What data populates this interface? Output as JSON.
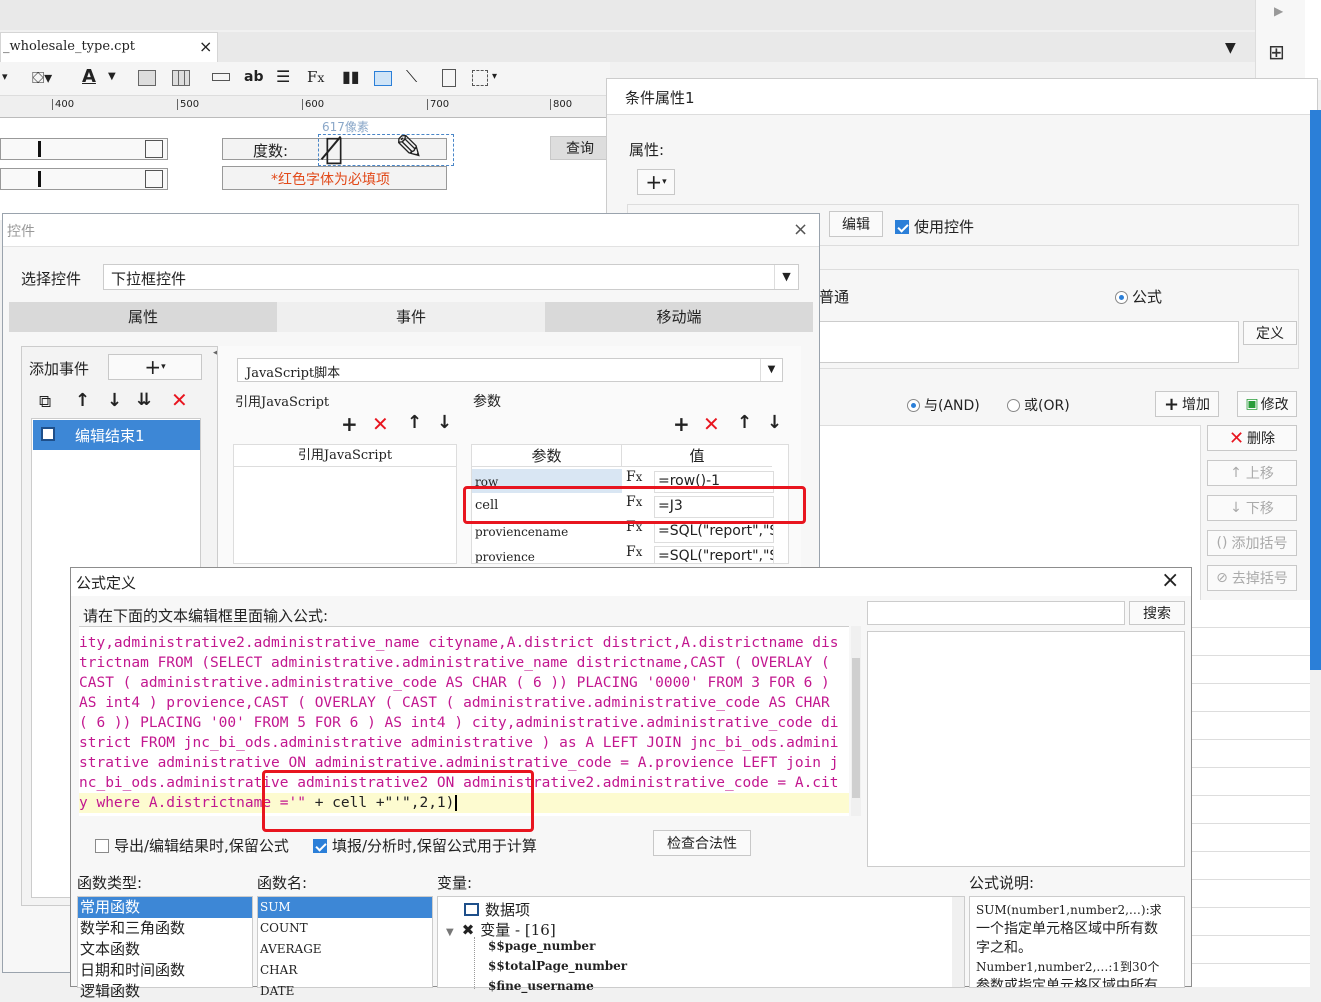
{
  "editor_tab": {
    "filename": "_wholesale_type.cpt",
    "close": "×"
  },
  "ruler": {
    "marks": [
      "400",
      "500",
      "600",
      "700",
      "800"
    ]
  },
  "canvas": {
    "widget_label": "度数:",
    "required_hint": "*红色字体为必填项",
    "size_label": "617像素",
    "query_button": "查询"
  },
  "right_panel": {
    "title": "条件属性1",
    "attr_label": "属性:",
    "add": "+",
    "edit_button": "编辑",
    "use_widget_label": "使用控件",
    "mode_normal": "普通",
    "mode_formula": "公式",
    "define_button": "定义",
    "and_label": "与(AND)",
    "or_label": "或(OR)",
    "add_button": "增加",
    "modify_button": "修改",
    "delete_button": "删除",
    "move_up_button": "上移",
    "move_down_button": "下移",
    "add_bracket_button": "添加括号",
    "remove_bracket_button": "去掉括号"
  },
  "widget_dialog": {
    "title": "控件",
    "select_label": "选择控件",
    "select_value": "下拉框控件",
    "tabs": [
      "属性",
      "事件",
      "移动端"
    ],
    "add_event_label": "添加事件",
    "event_item": "编辑结束1",
    "script_type": "JavaScript脚本",
    "ref_js_label": "引用JavaScript",
    "params_label": "参数",
    "ref_js_column": "引用JavaScript",
    "param_header": "参数",
    "value_header": "值",
    "params": [
      {
        "name": "row",
        "value": "=row()-1"
      },
      {
        "name": "cell",
        "value": "=J3"
      },
      {
        "name": "proviencename",
        "value": "=SQL(\"report\",\"S"
      },
      {
        "name": "provience",
        "value": "=SQL(\"report\",\"S"
      }
    ]
  },
  "formula_dialog": {
    "title": "公式定义",
    "close": "×",
    "instruction": "请在下面的文本编辑框里面输入公式:",
    "search_button": "搜索",
    "code_lines": [
      "ity,administrative2.administrative_name cityname,A.district district,A.districtname dis",
      "trictnam FROM (SELECT administrative.administrative_name districtname,CAST ( OVERLAY (",
      "CAST ( administrative.administrative_code AS CHAR ( 6 )) PLACING '0000' FROM 3 FOR 6 )",
      "AS int4 ) provience,CAST ( OVERLAY ( CAST ( administrative.administrative_code AS CHAR",
      "( 6 )) PLACING '00' FROM 5 FOR 6 ) AS int4 ) city,administrative.administrative_code di",
      "strict FROM jnc_bi_ods.administrative administrative ) as A LEFT JOIN jnc_bi_ods.admini",
      "strative administrative ON administrative.administrative_code = A.provience LEFT join j",
      "nc_bi_ods.administrative administrative2 ON administrative2.administrative_code = A.cit"
    ],
    "last_line_magenta": "y where A.districtname ='\"",
    "last_line_black": " + cell +\"'\",2,1)",
    "option_export": "导出/编辑结果时,保留公式",
    "option_fill": "填报/分析时,保留公式用于计算",
    "check_button": "检查合法性",
    "func_type_label": "函数类型:",
    "func_types": [
      "常用函数",
      "数学和三角函数",
      "文本函数",
      "日期和时间函数",
      "逻辑函数"
    ],
    "func_name_label": "函数名:",
    "func_names": [
      "SUM",
      "COUNT",
      "AVERAGE",
      "CHAR",
      "DATE"
    ],
    "var_label": "变量:",
    "var_tree": [
      {
        "text": "数据项",
        "level": 0
      },
      {
        "text": "变量 - [16]",
        "level": 0
      },
      {
        "text": "$$page_number",
        "level": 1
      },
      {
        "text": "$$totalPage_number",
        "level": 1
      },
      {
        "text": "$fine_username",
        "level": 1
      }
    ],
    "desc_label": "公式说明:",
    "desc_lines": [
      "SUM(number1,number2,…):求",
      "一个指定单元格区域中所有数",
      "字之和。",
      "Number1,number2,…:1到30个",
      "参数或指定单元格区域中所有"
    ]
  },
  "colors": {
    "accent": "#2b7fd8",
    "highlight_red": "#e8151f",
    "code_magenta": "#c2178f",
    "line_highlight": "#fdfbd0",
    "list_selected": "#3d87d6"
  }
}
